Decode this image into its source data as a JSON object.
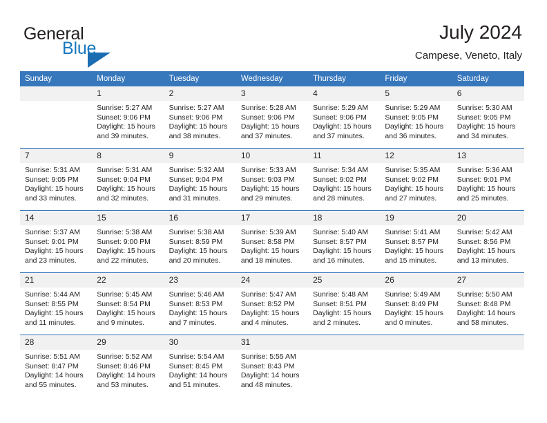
{
  "brand": {
    "name_part1": "General",
    "name_part2": "Blue",
    "triangle_color": "#1b6cb0",
    "accent_color": "#1878be"
  },
  "header": {
    "title": "July 2024",
    "subtitle": "Campese, Veneto, Italy",
    "header_bg": "#3777bc",
    "daynum_bg": "#f1f1f1"
  },
  "weekdays": [
    "Sunday",
    "Monday",
    "Tuesday",
    "Wednesday",
    "Thursday",
    "Friday",
    "Saturday"
  ],
  "labels": {
    "sunrise_prefix": "Sunrise:",
    "sunset_prefix": "Sunset:",
    "daylight_prefix": "Daylight:"
  },
  "weeks": [
    [
      {
        "day": "",
        "sunrise": "",
        "sunset": "",
        "daylight_line1": "",
        "daylight_line2": ""
      },
      {
        "day": "1",
        "sunrise": "Sunrise: 5:27 AM",
        "sunset": "Sunset: 9:06 PM",
        "daylight_line1": "Daylight: 15 hours",
        "daylight_line2": "and 39 minutes."
      },
      {
        "day": "2",
        "sunrise": "Sunrise: 5:27 AM",
        "sunset": "Sunset: 9:06 PM",
        "daylight_line1": "Daylight: 15 hours",
        "daylight_line2": "and 38 minutes."
      },
      {
        "day": "3",
        "sunrise": "Sunrise: 5:28 AM",
        "sunset": "Sunset: 9:06 PM",
        "daylight_line1": "Daylight: 15 hours",
        "daylight_line2": "and 37 minutes."
      },
      {
        "day": "4",
        "sunrise": "Sunrise: 5:29 AM",
        "sunset": "Sunset: 9:06 PM",
        "daylight_line1": "Daylight: 15 hours",
        "daylight_line2": "and 37 minutes."
      },
      {
        "day": "5",
        "sunrise": "Sunrise: 5:29 AM",
        "sunset": "Sunset: 9:05 PM",
        "daylight_line1": "Daylight: 15 hours",
        "daylight_line2": "and 36 minutes."
      },
      {
        "day": "6",
        "sunrise": "Sunrise: 5:30 AM",
        "sunset": "Sunset: 9:05 PM",
        "daylight_line1": "Daylight: 15 hours",
        "daylight_line2": "and 34 minutes."
      }
    ],
    [
      {
        "day": "7",
        "sunrise": "Sunrise: 5:31 AM",
        "sunset": "Sunset: 9:05 PM",
        "daylight_line1": "Daylight: 15 hours",
        "daylight_line2": "and 33 minutes."
      },
      {
        "day": "8",
        "sunrise": "Sunrise: 5:31 AM",
        "sunset": "Sunset: 9:04 PM",
        "daylight_line1": "Daylight: 15 hours",
        "daylight_line2": "and 32 minutes."
      },
      {
        "day": "9",
        "sunrise": "Sunrise: 5:32 AM",
        "sunset": "Sunset: 9:04 PM",
        "daylight_line1": "Daylight: 15 hours",
        "daylight_line2": "and 31 minutes."
      },
      {
        "day": "10",
        "sunrise": "Sunrise: 5:33 AM",
        "sunset": "Sunset: 9:03 PM",
        "daylight_line1": "Daylight: 15 hours",
        "daylight_line2": "and 29 minutes."
      },
      {
        "day": "11",
        "sunrise": "Sunrise: 5:34 AM",
        "sunset": "Sunset: 9:02 PM",
        "daylight_line1": "Daylight: 15 hours",
        "daylight_line2": "and 28 minutes."
      },
      {
        "day": "12",
        "sunrise": "Sunrise: 5:35 AM",
        "sunset": "Sunset: 9:02 PM",
        "daylight_line1": "Daylight: 15 hours",
        "daylight_line2": "and 27 minutes."
      },
      {
        "day": "13",
        "sunrise": "Sunrise: 5:36 AM",
        "sunset": "Sunset: 9:01 PM",
        "daylight_line1": "Daylight: 15 hours",
        "daylight_line2": "and 25 minutes."
      }
    ],
    [
      {
        "day": "14",
        "sunrise": "Sunrise: 5:37 AM",
        "sunset": "Sunset: 9:01 PM",
        "daylight_line1": "Daylight: 15 hours",
        "daylight_line2": "and 23 minutes."
      },
      {
        "day": "15",
        "sunrise": "Sunrise: 5:38 AM",
        "sunset": "Sunset: 9:00 PM",
        "daylight_line1": "Daylight: 15 hours",
        "daylight_line2": "and 22 minutes."
      },
      {
        "day": "16",
        "sunrise": "Sunrise: 5:38 AM",
        "sunset": "Sunset: 8:59 PM",
        "daylight_line1": "Daylight: 15 hours",
        "daylight_line2": "and 20 minutes."
      },
      {
        "day": "17",
        "sunrise": "Sunrise: 5:39 AM",
        "sunset": "Sunset: 8:58 PM",
        "daylight_line1": "Daylight: 15 hours",
        "daylight_line2": "and 18 minutes."
      },
      {
        "day": "18",
        "sunrise": "Sunrise: 5:40 AM",
        "sunset": "Sunset: 8:57 PM",
        "daylight_line1": "Daylight: 15 hours",
        "daylight_line2": "and 16 minutes."
      },
      {
        "day": "19",
        "sunrise": "Sunrise: 5:41 AM",
        "sunset": "Sunset: 8:57 PM",
        "daylight_line1": "Daylight: 15 hours",
        "daylight_line2": "and 15 minutes."
      },
      {
        "day": "20",
        "sunrise": "Sunrise: 5:42 AM",
        "sunset": "Sunset: 8:56 PM",
        "daylight_line1": "Daylight: 15 hours",
        "daylight_line2": "and 13 minutes."
      }
    ],
    [
      {
        "day": "21",
        "sunrise": "Sunrise: 5:44 AM",
        "sunset": "Sunset: 8:55 PM",
        "daylight_line1": "Daylight: 15 hours",
        "daylight_line2": "and 11 minutes."
      },
      {
        "day": "22",
        "sunrise": "Sunrise: 5:45 AM",
        "sunset": "Sunset: 8:54 PM",
        "daylight_line1": "Daylight: 15 hours",
        "daylight_line2": "and 9 minutes."
      },
      {
        "day": "23",
        "sunrise": "Sunrise: 5:46 AM",
        "sunset": "Sunset: 8:53 PM",
        "daylight_line1": "Daylight: 15 hours",
        "daylight_line2": "and 7 minutes."
      },
      {
        "day": "24",
        "sunrise": "Sunrise: 5:47 AM",
        "sunset": "Sunset: 8:52 PM",
        "daylight_line1": "Daylight: 15 hours",
        "daylight_line2": "and 4 minutes."
      },
      {
        "day": "25",
        "sunrise": "Sunrise: 5:48 AM",
        "sunset": "Sunset: 8:51 PM",
        "daylight_line1": "Daylight: 15 hours",
        "daylight_line2": "and 2 minutes."
      },
      {
        "day": "26",
        "sunrise": "Sunrise: 5:49 AM",
        "sunset": "Sunset: 8:49 PM",
        "daylight_line1": "Daylight: 15 hours",
        "daylight_line2": "and 0 minutes."
      },
      {
        "day": "27",
        "sunrise": "Sunrise: 5:50 AM",
        "sunset": "Sunset: 8:48 PM",
        "daylight_line1": "Daylight: 14 hours",
        "daylight_line2": "and 58 minutes."
      }
    ],
    [
      {
        "day": "28",
        "sunrise": "Sunrise: 5:51 AM",
        "sunset": "Sunset: 8:47 PM",
        "daylight_line1": "Daylight: 14 hours",
        "daylight_line2": "and 55 minutes."
      },
      {
        "day": "29",
        "sunrise": "Sunrise: 5:52 AM",
        "sunset": "Sunset: 8:46 PM",
        "daylight_line1": "Daylight: 14 hours",
        "daylight_line2": "and 53 minutes."
      },
      {
        "day": "30",
        "sunrise": "Sunrise: 5:54 AM",
        "sunset": "Sunset: 8:45 PM",
        "daylight_line1": "Daylight: 14 hours",
        "daylight_line2": "and 51 minutes."
      },
      {
        "day": "31",
        "sunrise": "Sunrise: 5:55 AM",
        "sunset": "Sunset: 8:43 PM",
        "daylight_line1": "Daylight: 14 hours",
        "daylight_line2": "and 48 minutes."
      },
      {
        "day": "",
        "sunrise": "",
        "sunset": "",
        "daylight_line1": "",
        "daylight_line2": ""
      },
      {
        "day": "",
        "sunrise": "",
        "sunset": "",
        "daylight_line1": "",
        "daylight_line2": ""
      },
      {
        "day": "",
        "sunrise": "",
        "sunset": "",
        "daylight_line1": "",
        "daylight_line2": ""
      }
    ]
  ]
}
